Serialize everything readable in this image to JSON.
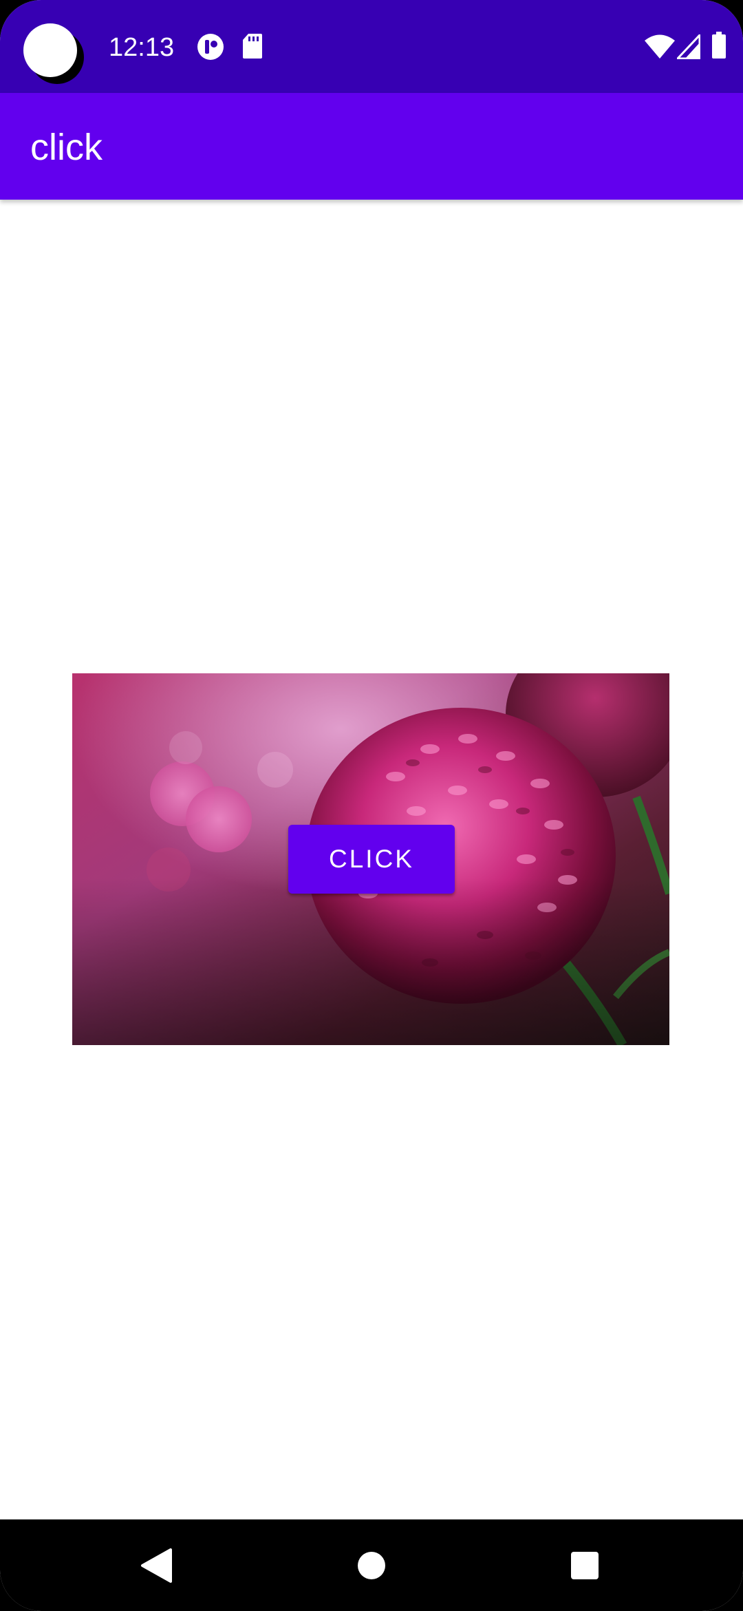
{
  "status_bar": {
    "time": "12:13",
    "icons": [
      "notification-app-icon",
      "sd-card-icon",
      "wifi-icon",
      "cell-signal-icon",
      "battery-icon"
    ],
    "background": "#3700b3"
  },
  "app_bar": {
    "title": "click",
    "background": "#6200ee"
  },
  "content": {
    "image": "flower-image",
    "button_label": "CLICK",
    "button_color": "#6200ee"
  },
  "nav_bar": {
    "buttons": [
      "back-icon",
      "home-icon",
      "recents-icon"
    ]
  }
}
